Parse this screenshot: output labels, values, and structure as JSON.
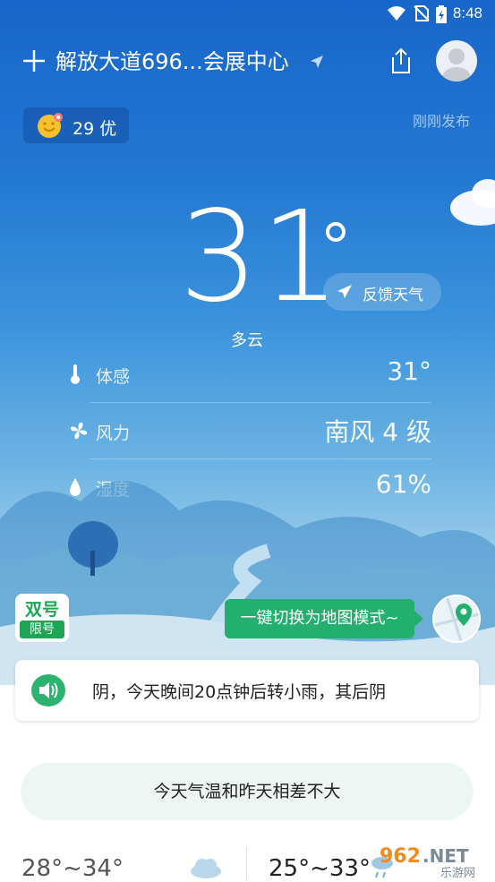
{
  "status_bar": {
    "time": "8:48"
  },
  "header": {
    "location": "解放大道696...会展中心"
  },
  "aqi": {
    "value": "29",
    "level": "优",
    "label": "29 优"
  },
  "publish_status": "刚刚发布",
  "current": {
    "temperature": "31",
    "condition": "多云",
    "feedback_label": "反馈天气"
  },
  "details": [
    {
      "label": "体感",
      "value": "31°",
      "icon": "thermometer-icon"
    },
    {
      "label": "风力",
      "value": "南风 4 级",
      "icon": "fan-icon"
    },
    {
      "label": "湿度",
      "value": "61%",
      "icon": "droplet-icon"
    }
  ],
  "traffic_limit": {
    "top": "双号",
    "bottom": "限号"
  },
  "map_tip": "一键切换为地图模式~",
  "alert": {
    "text": "阴，今天晚间20点钟后转小雨，其后阴"
  },
  "compare": "今天气温和昨天相差不大",
  "forecast": {
    "today_range": "28°~34°",
    "tomorrow_range": "25°~33°"
  },
  "watermark": {
    "text": "962.NET",
    "sub": "乐游网"
  },
  "colors": {
    "accent_green": "#23b06f",
    "sky_top": "#1866c9",
    "limit_green": "#1ea455"
  }
}
